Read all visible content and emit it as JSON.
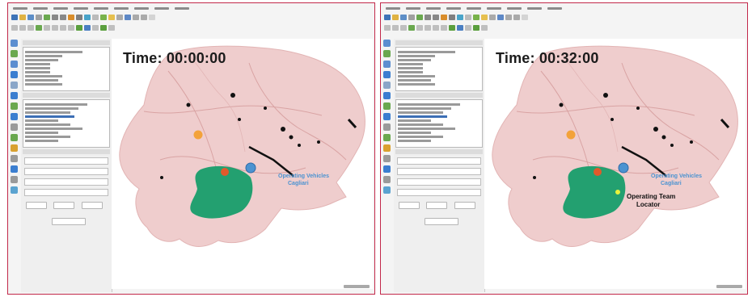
{
  "panels": [
    {
      "time_label": "Time: 00:00:00",
      "operating_annotation": [
        "Operating Vehicles",
        "Cagliari"
      ],
      "show_team_locator": false
    },
    {
      "time_label": "Time: 00:32:00",
      "operating_annotation": [
        "Operating Vehicles",
        "Cagliari"
      ],
      "show_team_locator": true,
      "team_locator_label": [
        "Operating Team",
        "Locator"
      ]
    }
  ],
  "colors": {
    "frame_border": "#c2284a",
    "land": "#efcdcd",
    "road": "#d9a3a3",
    "zone": "#23a070",
    "incident": "#e05a2b",
    "orange_marker": "#f3a23a",
    "base": "#4b93d1",
    "locator": "#e7f23c"
  },
  "icons": [
    "toolbar-icons",
    "map-tool-icons",
    "layers-tree"
  ]
}
